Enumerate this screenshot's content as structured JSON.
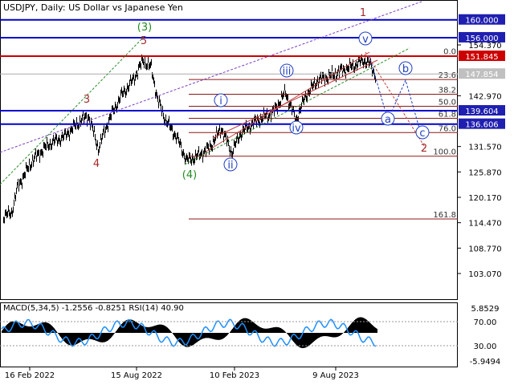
{
  "header": {
    "title": "USDJPY, Daily:  US Dollar vs Japanese Yen"
  },
  "indicator": {
    "title": "MACD(5,34,5) -1.2556 -0.8251 RSI(14) 40.90"
  },
  "colors": {
    "background": "#ffffff",
    "price": "#000000",
    "level_line": "#0000cc",
    "red_line": "#cc0000",
    "fib_line": "#8b1a1a",
    "green_wave": "#228b22",
    "blue_wave": "#1f3fbf",
    "red_wave": "#a52a2a",
    "rsi_line": "#1e90ff"
  },
  "chart_data": {
    "type": "line",
    "symbol": "USDJPY",
    "timeframe": "Daily",
    "ylim": [
      97.0,
      160.5
    ],
    "price_ticks": [
      "154.370",
      "142.970",
      "131.570",
      "125.870",
      "120.170",
      "114.470",
      "108.770",
      "103.070"
    ],
    "x_ticks": [
      "16 Feb 2022",
      "15 Aug 2022",
      "10 Feb 2023",
      "9 Aug 2023"
    ],
    "levels": [
      {
        "label": "160.000",
        "value": 160.0,
        "style": "blue"
      },
      {
        "label": "156.000",
        "value": 156.0,
        "style": "blue"
      },
      {
        "label": "151.845",
        "value": 151.845,
        "style": "red"
      },
      {
        "label": "147.854",
        "value": 147.854,
        "style": "current"
      },
      {
        "label": "139.604",
        "value": 139.604,
        "style": "blue"
      },
      {
        "label": "136.606",
        "value": 136.606,
        "style": "blue"
      }
    ],
    "fibonacci": [
      {
        "label": "0.0",
        "value": 151.9
      },
      {
        "label": "23.6",
        "value": 146.6
      },
      {
        "label": "38.2",
        "value": 143.3
      },
      {
        "label": "50.0",
        "value": 140.6
      },
      {
        "label": "61.8",
        "value": 137.9
      },
      {
        "label": "76.0",
        "value": 134.7
      },
      {
        "label": "100.0",
        "value": 129.4
      },
      {
        "label": "161.8",
        "value": 115.3
      }
    ],
    "wave_labels": [
      {
        "text": "(3)",
        "color": "green"
      },
      {
        "text": "(4)",
        "color": "green"
      },
      {
        "text": "3",
        "color": "red"
      },
      {
        "text": "4",
        "color": "red"
      },
      {
        "text": "5",
        "color": "red"
      },
      {
        "text": "1",
        "color": "red"
      },
      {
        "text": "2",
        "color": "red"
      },
      {
        "text": "i",
        "color": "blue"
      },
      {
        "text": "ii",
        "color": "blue"
      },
      {
        "text": "iii",
        "color": "blue"
      },
      {
        "text": "iv",
        "color": "blue"
      },
      {
        "text": "v",
        "color": "blue"
      },
      {
        "text": "a",
        "color": "blue"
      },
      {
        "text": "b",
        "color": "blue"
      },
      {
        "text": "c",
        "color": "blue"
      }
    ],
    "macd_ticks": [
      "5.8529",
      "70.00",
      "30.00",
      "-5.9494"
    ]
  }
}
